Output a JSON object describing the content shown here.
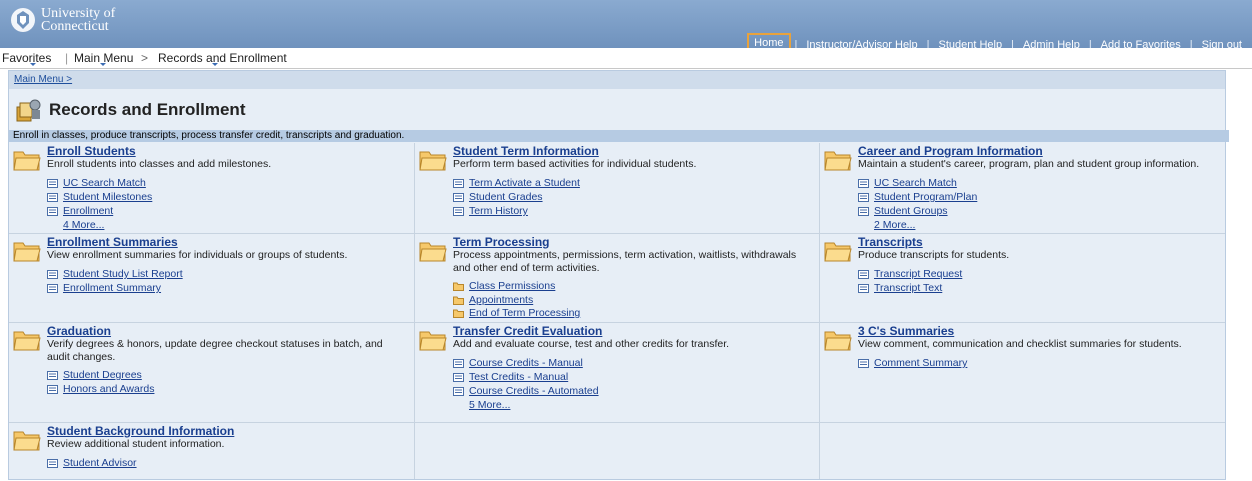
{
  "header": {
    "logo_line1": "University of",
    "logo_line2": "Connecticut",
    "links": [
      "Home",
      "Instructor/Advisor Help",
      "Student Help",
      "Admin Help",
      "Add to Favorites",
      "Sign out"
    ]
  },
  "nav": {
    "items": [
      "Favorites",
      "Main Menu",
      ">",
      "Records and Enrollment"
    ]
  },
  "page": {
    "crumb": "Main Menu >",
    "title": "Records and Enrollment",
    "description": "Enroll in classes, produce transcripts, process transfer credit, transcripts and graduation."
  },
  "colors": {
    "header": "#7a9ac4",
    "frame": "#e7eef6",
    "desc_bar": "#b6cbe3",
    "link": "#1a3f8f",
    "home_highlight": "#e8a23c"
  },
  "cells": [
    {
      "title": "Enroll Students",
      "desc": "Enroll students into classes and add milestones.",
      "links": [
        {
          "label": "UC Search Match",
          "icon": "page-icon"
        },
        {
          "label": "Student Milestones",
          "icon": "page-icon"
        },
        {
          "label": "Enrollment",
          "icon": "page-icon"
        }
      ],
      "more": "4 More..."
    },
    {
      "title": "Student Term Information",
      "desc": "Perform term based activities for individual students.",
      "links": [
        {
          "label": "Term Activate a Student",
          "icon": "page-icon"
        },
        {
          "label": "Student Grades",
          "icon": "page-icon"
        },
        {
          "label": "Term History",
          "icon": "page-icon"
        }
      ],
      "more": ""
    },
    {
      "title": "Career and Program Information",
      "desc": "Maintain a student's career, program, plan and student group information.",
      "links": [
        {
          "label": "UC Search Match",
          "icon": "page-icon"
        },
        {
          "label": "Student Program/Plan",
          "icon": "page-icon"
        },
        {
          "label": "Student Groups",
          "icon": "page-icon"
        }
      ],
      "more": "2 More..."
    },
    {
      "title": "Enrollment Summaries",
      "desc": "View enrollment summaries for individuals or groups of students.",
      "links": [
        {
          "label": "Student Study List Report",
          "icon": "page-icon"
        },
        {
          "label": "Enrollment Summary",
          "icon": "page-icon"
        }
      ],
      "more": ""
    },
    {
      "title": "Term Processing",
      "desc": "Process appointments, permissions, term activation, waitlists, withdrawals and other end of term activities.",
      "links": [
        {
          "label": "Class Permissions",
          "icon": "folder-icon"
        },
        {
          "label": "Appointments",
          "icon": "folder-icon"
        },
        {
          "label": "End of Term Processing",
          "icon": "folder-icon"
        }
      ],
      "more": ""
    },
    {
      "title": "Transcripts",
      "desc": "Produce transcripts for students.",
      "links": [
        {
          "label": "Transcript Request",
          "icon": "page-icon"
        },
        {
          "label": "Transcript Text",
          "icon": "page-icon"
        }
      ],
      "more": ""
    },
    {
      "title": "Graduation",
      "desc": "Verify degrees & honors, update degree checkout statuses in batch, and audit changes.",
      "links": [
        {
          "label": "Student Degrees",
          "icon": "page-icon"
        },
        {
          "label": "Honors and Awards",
          "icon": "page-icon"
        }
      ],
      "more": ""
    },
    {
      "title": "Transfer Credit Evaluation",
      "desc": "Add and evaluate course, test and other credits for transfer.",
      "links": [
        {
          "label": "Course Credits - Manual",
          "icon": "page-icon"
        },
        {
          "label": "Test Credits - Manual",
          "icon": "page-icon"
        },
        {
          "label": "Course Credits - Automated",
          "icon": "page-icon"
        }
      ],
      "more": "5 More..."
    },
    {
      "title": "3 C's Summaries",
      "desc": "View comment, communication and checklist summaries for students.",
      "links": [
        {
          "label": "Comment Summary",
          "icon": "page-icon"
        }
      ],
      "more": ""
    },
    {
      "title": "Student Background Information",
      "desc": "Review additional student information.",
      "links": [
        {
          "label": "Student Advisor",
          "icon": "page-icon"
        }
      ],
      "more": ""
    }
  ]
}
